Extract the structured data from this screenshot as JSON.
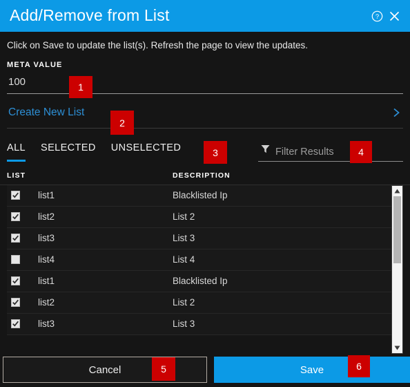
{
  "dialog": {
    "title": "Add/Remove from List",
    "help_icon": "help-circle-icon",
    "close_icon": "close-icon",
    "instruction": "Click on Save to update the list(s). Refresh the page to view the updates."
  },
  "meta_value": {
    "label": "META VALUE",
    "value": "100",
    "placeholder": ""
  },
  "create_new_list": {
    "label": "Create New List",
    "chevron_icon": "chevron-right-icon"
  },
  "tabs": [
    {
      "label": "ALL",
      "active": true
    },
    {
      "label": "SELECTED",
      "active": false
    },
    {
      "label": "UNSELECTED",
      "active": false
    }
  ],
  "filter": {
    "placeholder": "Filter Results",
    "value": "",
    "icon": "funnel-icon"
  },
  "table": {
    "columns": [
      "LIST",
      "DESCRIPTION"
    ],
    "rows": [
      {
        "checked": true,
        "list": "list1",
        "description": "Blacklisted Ip"
      },
      {
        "checked": true,
        "list": "list2",
        "description": "List 2"
      },
      {
        "checked": true,
        "list": "list3",
        "description": "List 3"
      },
      {
        "checked": false,
        "list": "list4",
        "description": "List 4"
      },
      {
        "checked": true,
        "list": "list1",
        "description": "Blacklisted Ip"
      },
      {
        "checked": true,
        "list": "list2",
        "description": "List 2"
      },
      {
        "checked": true,
        "list": "list3",
        "description": "List 3"
      }
    ]
  },
  "scrollbar": {
    "up_icon": "triangle-up-icon",
    "down_icon": "triangle-down-icon"
  },
  "footer": {
    "cancel_label": "Cancel",
    "save_label": "Save"
  },
  "annotations": [
    {
      "id": "1",
      "target": "meta-value-input"
    },
    {
      "id": "2",
      "target": "create-new-list-link"
    },
    {
      "id": "3",
      "target": "tabs-group"
    },
    {
      "id": "4",
      "target": "filter-input"
    },
    {
      "id": "5",
      "target": "cancel-button"
    },
    {
      "id": "6",
      "target": "save-button"
    }
  ],
  "colors": {
    "accent": "#0c9ae6",
    "link": "#2d8fd5",
    "annotation": "#cc0000",
    "background": "#151515",
    "row": "#191919"
  }
}
